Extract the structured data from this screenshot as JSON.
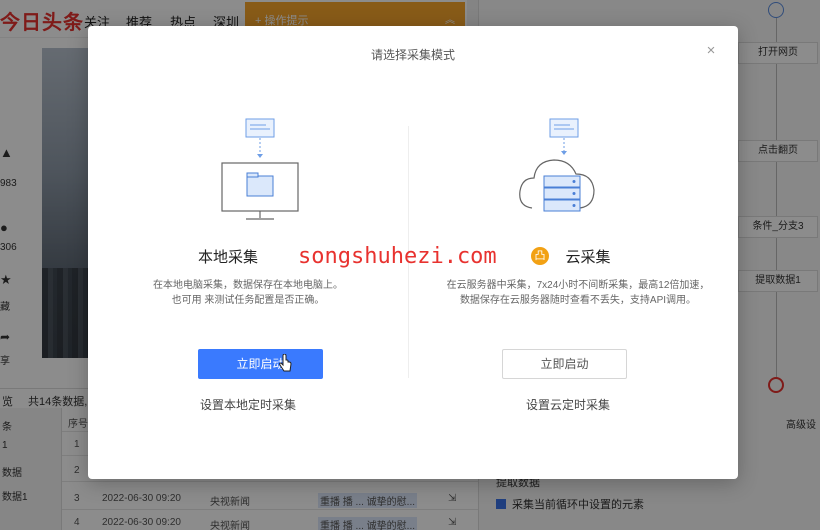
{
  "background": {
    "brand": "今日头条",
    "nav": [
      "关注",
      "推荐",
      "热点",
      "深圳"
    ],
    "operation_tip": "操作提示",
    "left_stats": [
      "983",
      "306",
      "藏",
      "享"
    ],
    "preview": {
      "title": "览",
      "count": "共14条数据,"
    },
    "sidebar_rows": [
      "条",
      "1",
      "数据",
      "数据1"
    ],
    "grid_header": "序号",
    "grid_rows": [
      {
        "index": "1",
        "date": "",
        "source": "",
        "text": ""
      },
      {
        "index": "2",
        "date": "",
        "source": "",
        "text": ""
      },
      {
        "index": "3",
        "date": "2022-06-30 09:20",
        "source": "央视新闻",
        "text": "重播 播 ... 诚挚的慰..."
      },
      {
        "index": "4",
        "date": "2022-06-30 09:20",
        "source": "央视新闻",
        "text": "重播 播 ... 诚挚的慰..."
      }
    ],
    "flow_nodes": [
      "打开网页",
      "点击翻页",
      "条件_分支3",
      "提取数据1"
    ],
    "advanced_settings": "高级设",
    "extract_label": "提取数据",
    "loop_checkbox_label": "采集当前循环中设置的元素"
  },
  "modal": {
    "title": "请选择采集模式",
    "close_icon": "close-icon",
    "local": {
      "title": "本地采集",
      "desc_line1": "在本地电脑采集，数据保存在本地电脑上。",
      "desc_line2": "也可用 来测试任务配置是否正确。",
      "button": "立即启动",
      "schedule": "设置本地定时采集"
    },
    "cloud": {
      "title": "云采集",
      "desc_line1": "在云服务器中采集，7x24小时不间断采集，最高12倍加速，",
      "desc_line2": "数据保存在云服务器随时查看不丢失，支持API调用。",
      "button": "立即启动",
      "schedule": "设置云定时采集"
    },
    "watermark": "songshuhezi.com",
    "hot_badge": "凸"
  },
  "colors": {
    "primary": "#3a7afe",
    "brand_red": "#e8322f",
    "tip_orange": "#f7a72d"
  }
}
